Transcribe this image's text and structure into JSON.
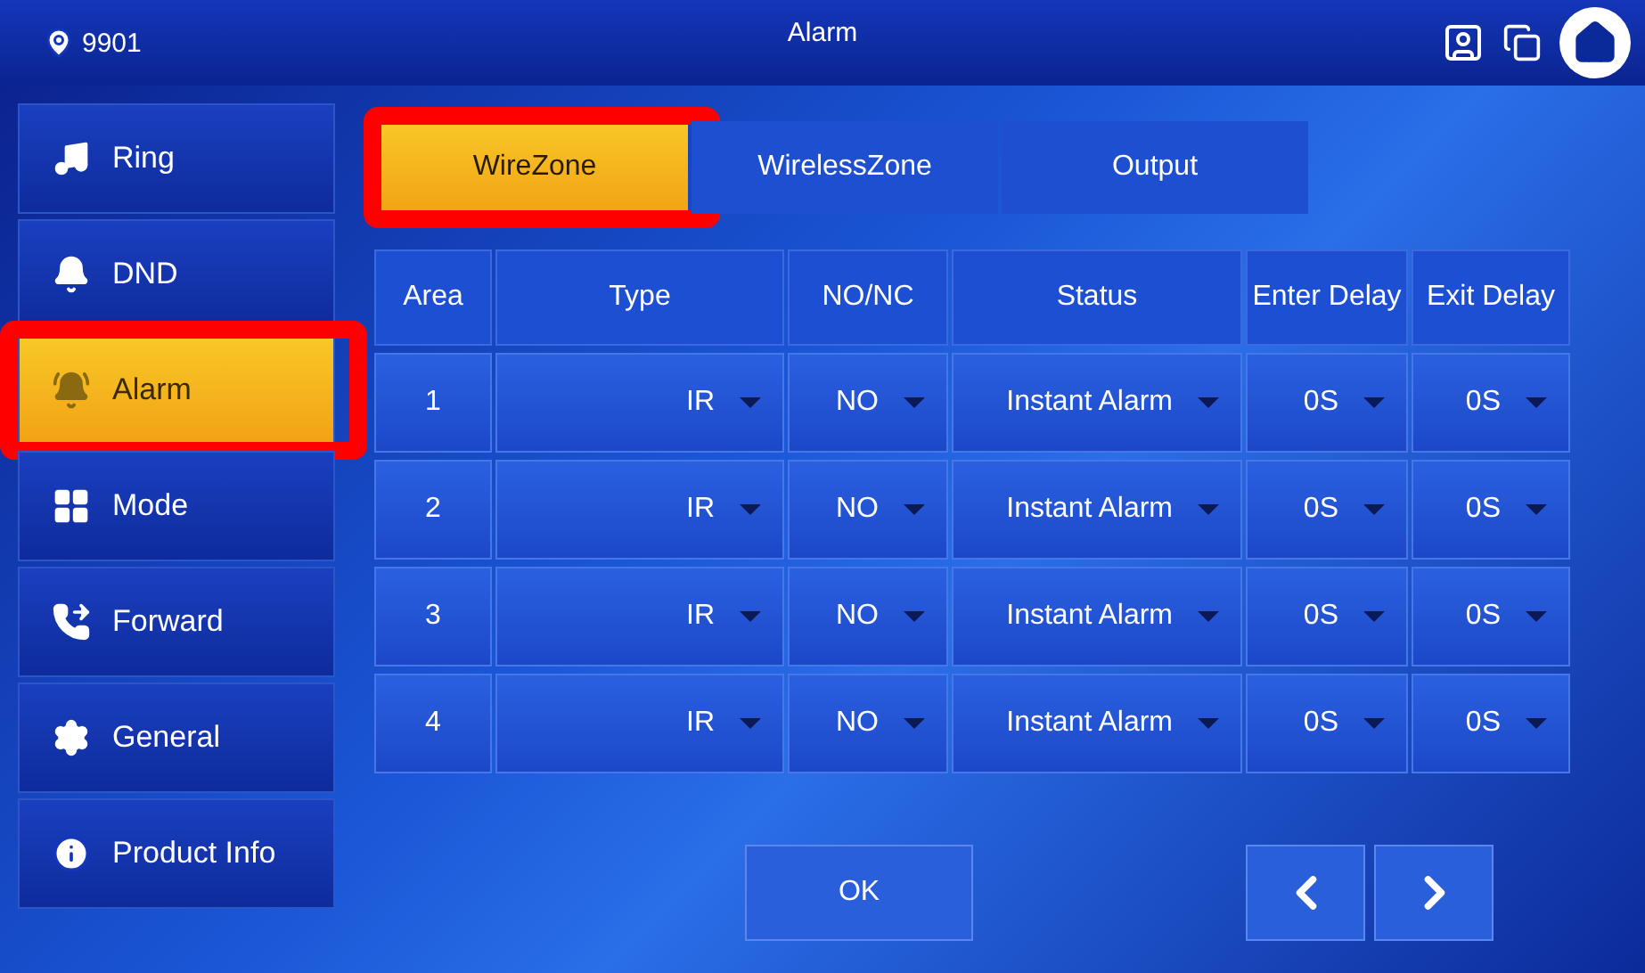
{
  "status_bar": {
    "location": "9901",
    "title": "Alarm"
  },
  "sidebar": {
    "items": [
      {
        "label": "Ring",
        "selected": false,
        "highlighted": false
      },
      {
        "label": "DND",
        "selected": false,
        "highlighted": false
      },
      {
        "label": "Alarm",
        "selected": true,
        "highlighted": true
      },
      {
        "label": "Mode",
        "selected": false,
        "highlighted": false
      },
      {
        "label": "Forward",
        "selected": false,
        "highlighted": false
      },
      {
        "label": "General",
        "selected": false,
        "highlighted": false
      },
      {
        "label": "Product Info",
        "selected": false,
        "highlighted": false
      }
    ]
  },
  "tabs": [
    {
      "label": "WireZone",
      "selected": true,
      "highlighted": true
    },
    {
      "label": "WirelessZone",
      "selected": false,
      "highlighted": false
    },
    {
      "label": "Output",
      "selected": false,
      "highlighted": false
    }
  ],
  "table": {
    "columns": [
      "Area",
      "Type",
      "NO/NC",
      "Status",
      "Enter Delay",
      "Exit Delay"
    ],
    "rows": [
      {
        "area": "1",
        "type": "IR",
        "mode": "NO",
        "status": "Instant Alarm",
        "enter_delay": "0S",
        "exit_delay": "0S"
      },
      {
        "area": "2",
        "type": "IR",
        "mode": "NO",
        "status": "Instant Alarm",
        "enter_delay": "0S",
        "exit_delay": "0S"
      },
      {
        "area": "3",
        "type": "IR",
        "mode": "NO",
        "status": "Instant Alarm",
        "enter_delay": "0S",
        "exit_delay": "0S"
      },
      {
        "area": "4",
        "type": "IR",
        "mode": "NO",
        "status": "Instant Alarm",
        "enter_delay": "0S",
        "exit_delay": "0S"
      }
    ]
  },
  "buttons": {
    "ok": "OK"
  }
}
